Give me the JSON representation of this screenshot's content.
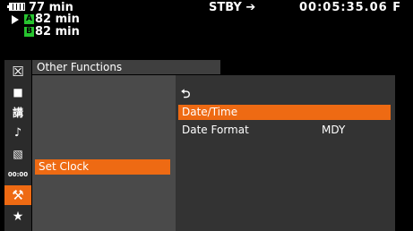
{
  "status": {
    "battery_time": "77 min",
    "slot_a_time": "82 min",
    "slot_b_time": "82 min",
    "slot_a_label": "A",
    "slot_b_label": "B",
    "mode": "STBY",
    "mode_icon": "➔",
    "timecode": "00:05:35.06 F"
  },
  "menu": {
    "title": "Other Functions",
    "selected_item": "Set Clock",
    "back_icon": "⮌",
    "submenu": [
      {
        "label": "Date/Time",
        "value": ""
      },
      {
        "label": "Date Format",
        "value": "MDY"
      }
    ]
  },
  "side_icons": [
    {
      "name": "close-icon",
      "glyph": "☒"
    },
    {
      "name": "camera-icon",
      "glyph": "■"
    },
    {
      "name": "custom-icon",
      "glyph": "講"
    },
    {
      "name": "audio-icon",
      "glyph": "♪"
    },
    {
      "name": "display-icon",
      "glyph": "▧"
    },
    {
      "name": "timecode-icon",
      "glyph": "00:00"
    },
    {
      "name": "wrench-icon",
      "glyph": "⚒"
    },
    {
      "name": "star-icon",
      "glyph": "★"
    }
  ],
  "colors": {
    "accent": "#ee6a13",
    "media_badge": "#27c42f"
  }
}
